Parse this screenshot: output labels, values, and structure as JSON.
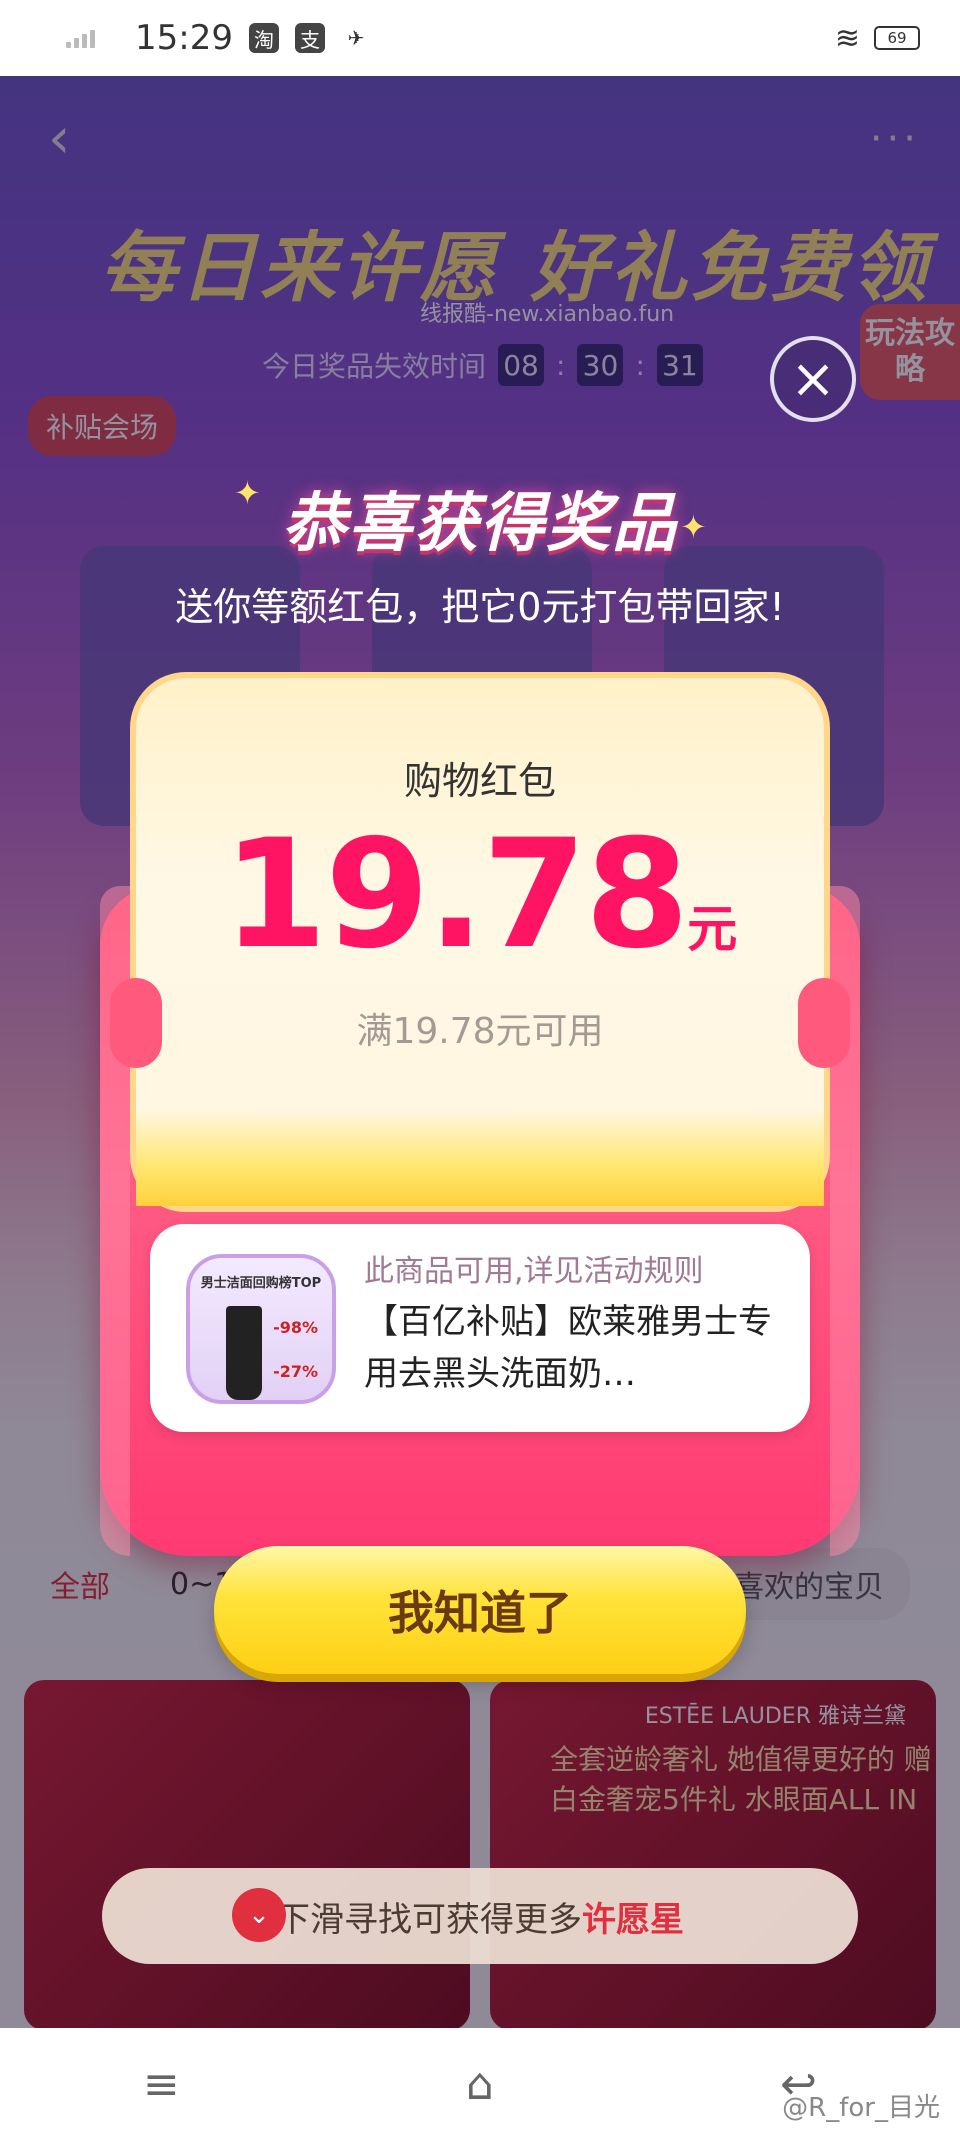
{
  "status_bar": {
    "time": "15:29",
    "app_icons": [
      "淘",
      "支",
      "✈"
    ],
    "battery": "69"
  },
  "background": {
    "banner": "每日来许愿 好礼免费领",
    "watermark": "线报酷-new.xianbao.fun",
    "timer_label": "今日奖品失效时间",
    "timer_h": "08",
    "timer_m": "30",
    "timer_s": "31",
    "guide_button": "玩法攻略",
    "subsidy_badge": "补贴会场",
    "tab_all": "全部",
    "tab_range": "0~10",
    "tab_hint": "喜欢的宝贝",
    "product_brand": "ESTĒE LAUDER 雅诗兰黛",
    "product_headline": "全套逆龄奢礼 她值得更好的 赠白金奢宠5件礼 水眼面ALL IN"
  },
  "modal": {
    "title": "恭喜获得奖品",
    "subtitle": "送你等额红包，把它0元打包带回家!",
    "coupon_label": "购物红包",
    "coupon_amount": "19.78",
    "coupon_unit": "元",
    "coupon_condition": "满19.78元可用",
    "product_hint": "此商品可用,详见活动规则",
    "product_name": "【百亿补贴】欧莱雅男士专用去黑头洗面奶…",
    "thumb_top": "男士洁面回购榜TOP",
    "thumb_badge1": "-98%",
    "thumb_badge2": "-27%",
    "ok_button": "我知道了"
  },
  "scroll_hint": {
    "text": "下滑寻找可获得更多",
    "accent": "许愿星"
  },
  "nav": {
    "weibo_credit": "@R_for_目光"
  },
  "colors": {
    "accent_red": "#ff1464",
    "button_yellow": "#ffe33a",
    "envelope_pink": "#ff3f64"
  },
  "icons": {
    "close": "close-icon",
    "back": "back-arrow-icon",
    "more": "more-icon",
    "scroll_down": "chevron-down-icon",
    "menu": "menu-icon",
    "home": "home-icon",
    "return": "back-icon"
  }
}
